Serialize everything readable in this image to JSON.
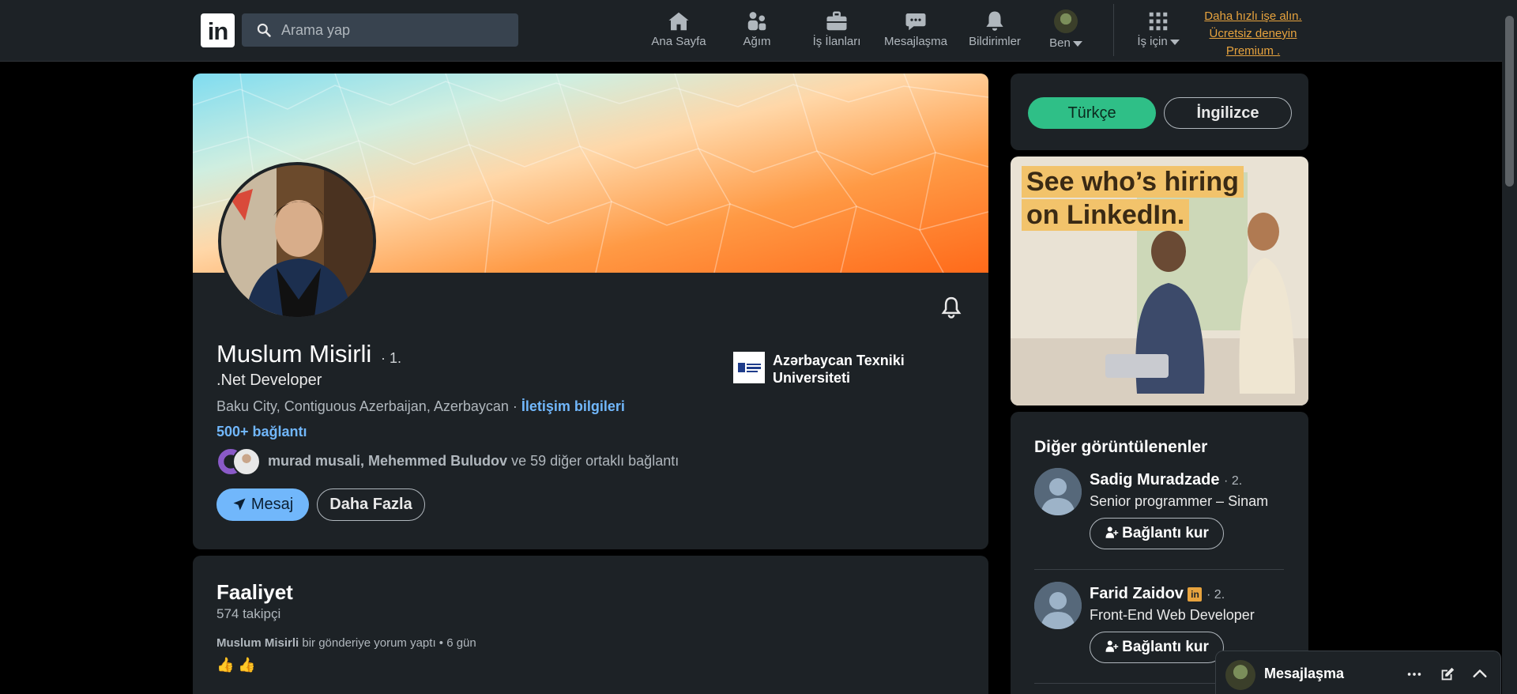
{
  "nav": {
    "logo": "in",
    "search_placeholder": "Arama yap",
    "items": [
      {
        "label": "Ana Sayfa",
        "icon": "home-icon"
      },
      {
        "label": "Ağım",
        "icon": "network-icon"
      },
      {
        "label": "İş İlanları",
        "icon": "briefcase-icon"
      },
      {
        "label": "Mesajlaşma",
        "icon": "messaging-icon"
      },
      {
        "label": "Bildirimler",
        "icon": "bell-icon"
      },
      {
        "label": "Ben",
        "icon": "avatar"
      },
      {
        "label": "İş için",
        "icon": "grid-icon"
      }
    ],
    "premium_line1": "Daha hızlı işe alın.",
    "premium_line2": "Ücretsiz deneyin",
    "premium_line3": "Premium ."
  },
  "profile": {
    "name": "Muslum Misirli",
    "degree": "· 1.",
    "headline": ".Net Developer",
    "location": "Baku City, Contiguous Azerbaijan, Azerbaycan ·",
    "contact_link": "İletişim bilgileri",
    "connections": "500+ bağlantı",
    "mutual_names": "murad musali, Mehemmed Buludov",
    "mutual_rest": "ve 59 diğer ortaklı bağlantı",
    "message_button": "Mesaj",
    "more_button": "Daha Fazla",
    "education_line1": "Azərbaycan Texniki",
    "education_line2": "Universiteti"
  },
  "activity": {
    "title": "Faaliyet",
    "followers": "574 takipçi",
    "post_author": "Muslum Misirli",
    "post_action": "bir gönderiye yorum yaptı • 6 gün",
    "emoji": "👍 👍"
  },
  "language": {
    "turkish": "Türkçe",
    "english": "İngilizce"
  },
  "ad": {
    "line1": "See who’s hiring",
    "line2": "on LinkedIn."
  },
  "others": {
    "title": "Diğer görüntülenenler",
    "people": [
      {
        "name": "Sadig Muradzade",
        "degree": "· 2.",
        "title": "Senior programmer – Sinam",
        "button": "Bağlantı kur"
      },
      {
        "name": "Farid Zaidov",
        "degree": "· 2.",
        "title": "Front-End Web Developer",
        "button": "Bağlantı kur",
        "badge": "in"
      }
    ]
  },
  "messaging_bar": {
    "label": "Mesajlaşma"
  },
  "colors": {
    "accent_blue": "#71b7fb",
    "accent_green": "#2fbf87",
    "premium": "#e7a33e",
    "card_bg": "#1d2226"
  }
}
